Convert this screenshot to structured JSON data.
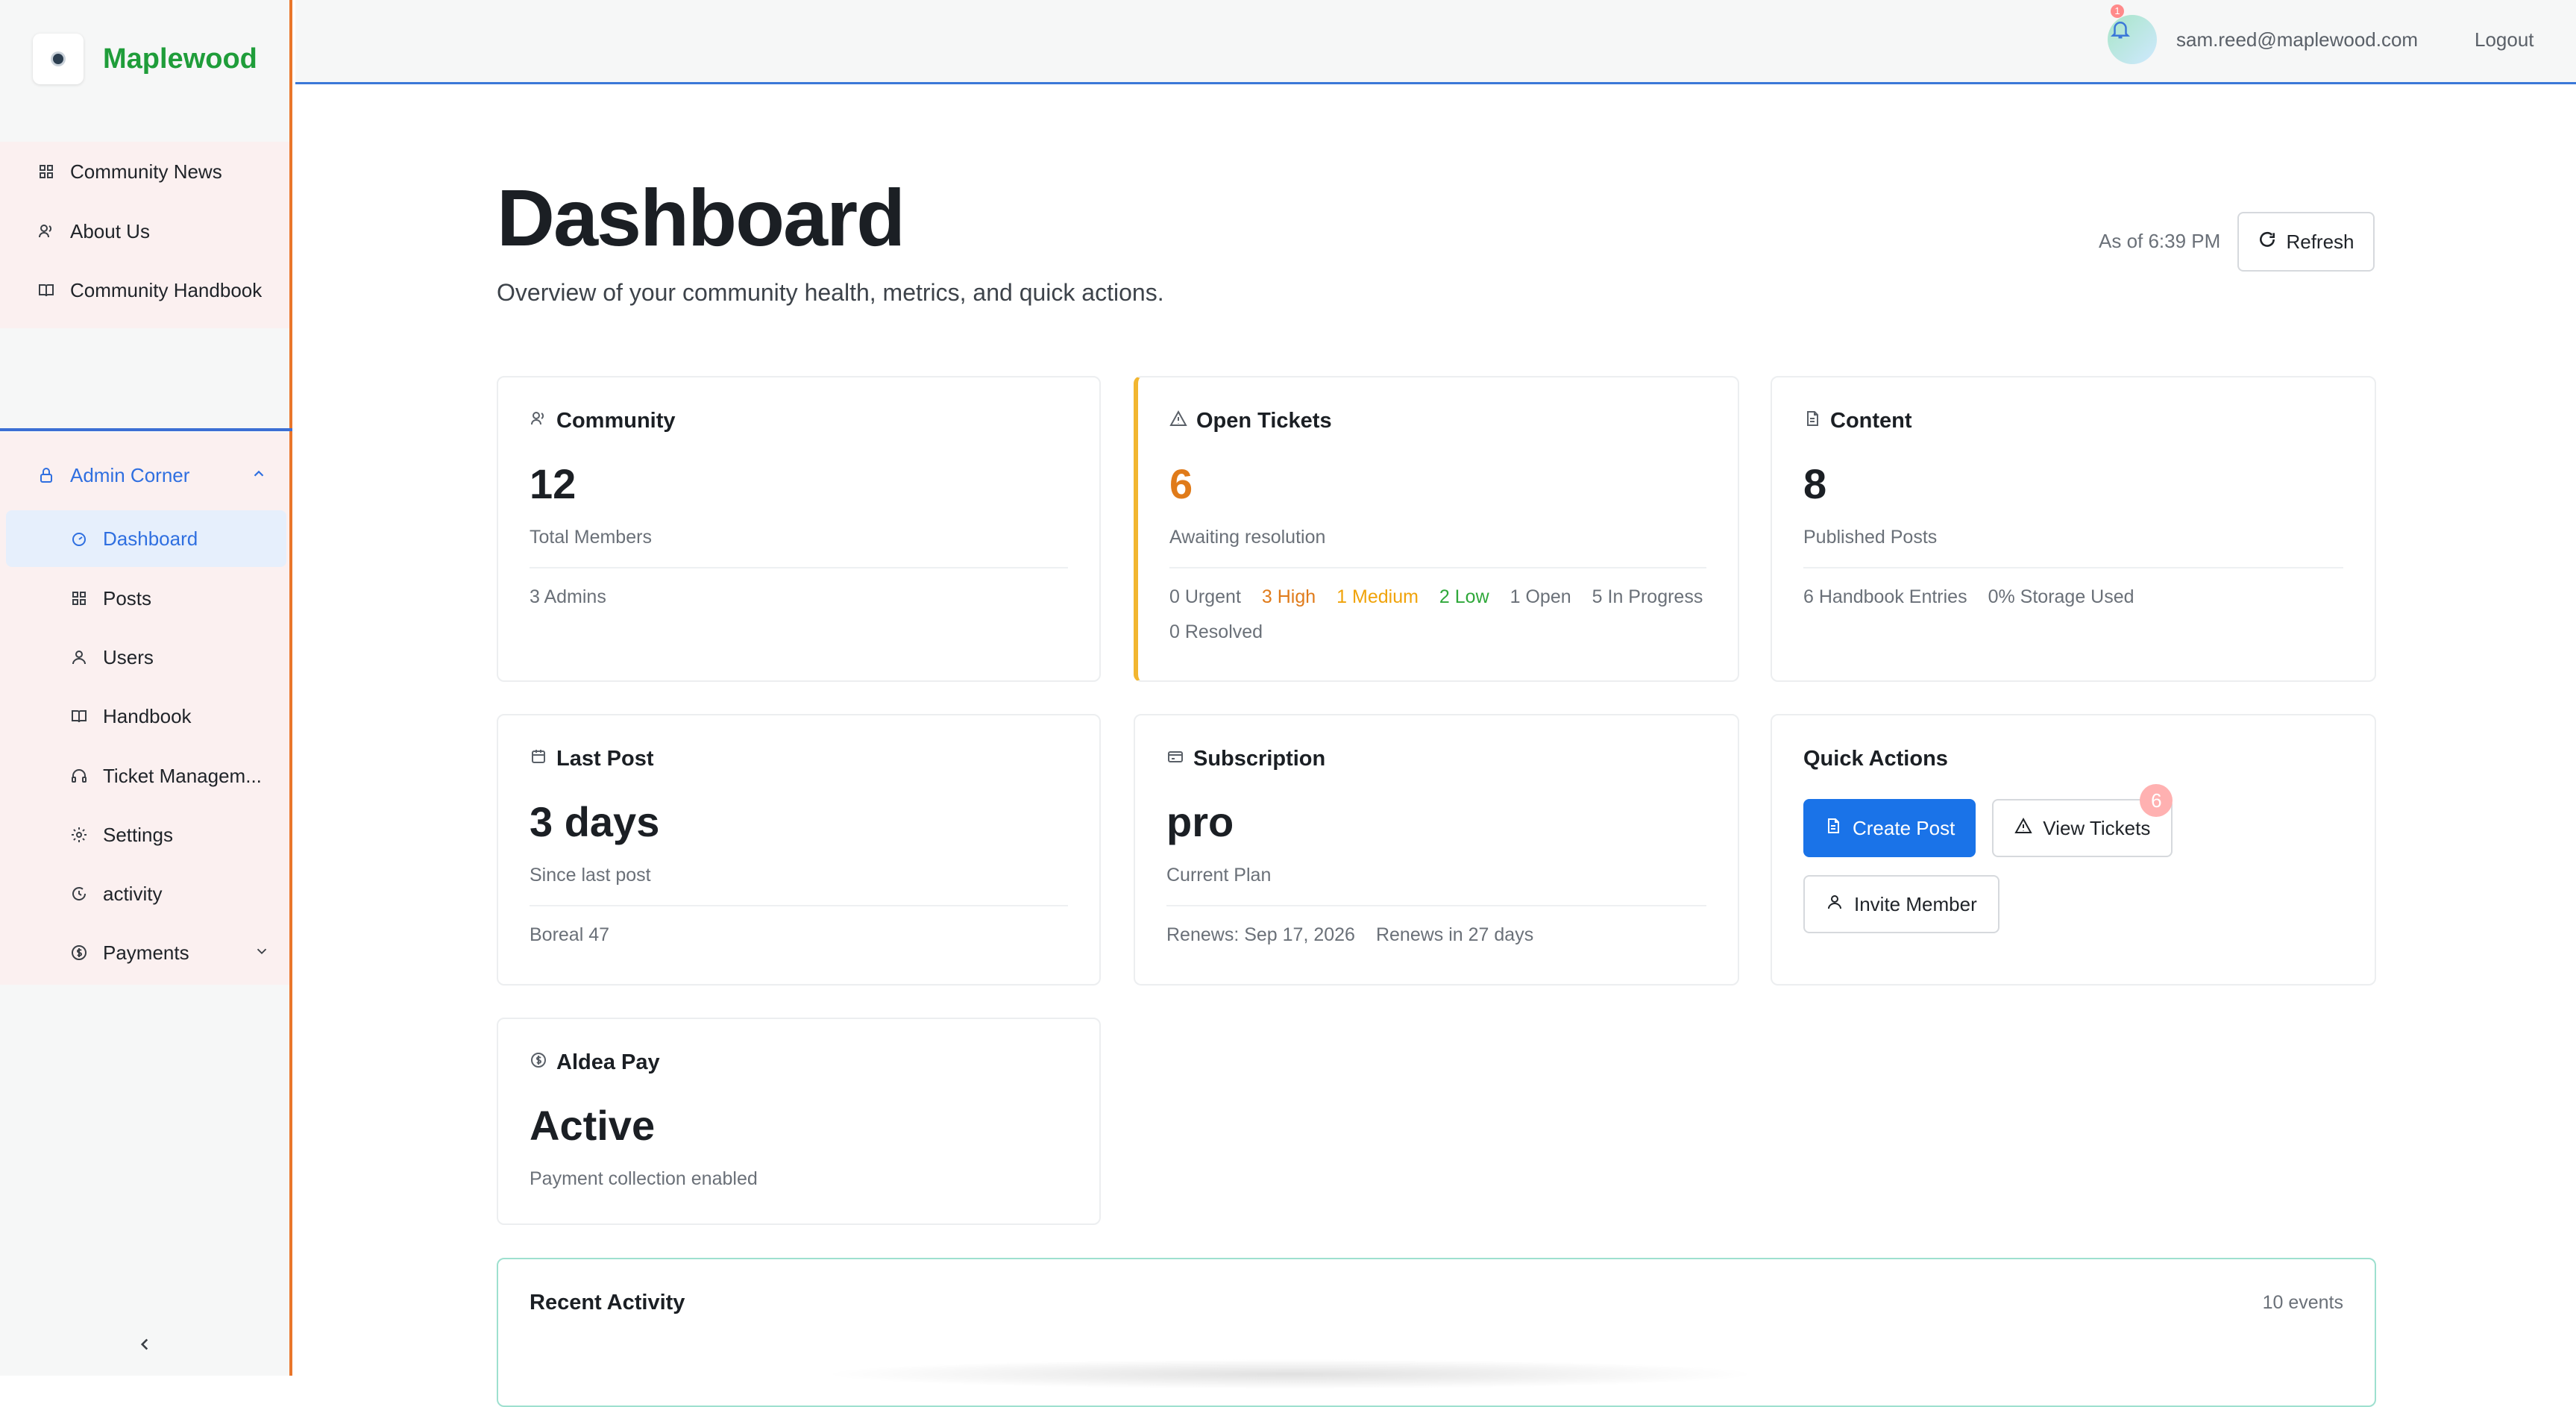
{
  "brand": {
    "name": "Maplewood"
  },
  "nav": {
    "main": [
      {
        "label": "Community News",
        "icon": "grid-icon"
      },
      {
        "label": "About Us",
        "icon": "people-icon"
      },
      {
        "label": "Community Handbook",
        "icon": "book-icon"
      }
    ],
    "admin": {
      "label": "Admin Corner",
      "items": [
        {
          "label": "Dashboard",
          "icon": "gauge-icon",
          "active": true
        },
        {
          "label": "Posts",
          "icon": "grid-icon"
        },
        {
          "label": "Users",
          "icon": "user-icon"
        },
        {
          "label": "Handbook",
          "icon": "book-icon"
        },
        {
          "label": "Ticket Managem...",
          "icon": "headset-icon"
        },
        {
          "label": "Settings",
          "icon": "gear-icon"
        },
        {
          "label": "activity",
          "icon": "history-icon"
        },
        {
          "label": "Payments",
          "icon": "dollar-icon"
        }
      ]
    }
  },
  "topbar": {
    "email": "sam.reed@maplewood.com",
    "logout": "Logout",
    "notification_count": "1"
  },
  "header": {
    "title": "Dashboard",
    "subtitle": "Overview of your community health, metrics, and quick actions.",
    "as_of": "As of 6:39 PM",
    "refresh": "Refresh"
  },
  "cards": {
    "community": {
      "title": "Community",
      "value": "12",
      "label": "Total Members",
      "foot": [
        "3 Admins"
      ]
    },
    "tickets": {
      "title": "Open Tickets",
      "value": "6",
      "label": "Awaiting resolution",
      "foot": [
        "0 Urgent",
        "3 High",
        "1 Medium",
        "2 Low",
        "1 Open",
        "5 In Progress",
        "0 Resolved"
      ]
    },
    "content": {
      "title": "Content",
      "value": "8",
      "label": "Published Posts",
      "foot": [
        "6 Handbook Entries",
        "0% Storage Used"
      ]
    },
    "last_post": {
      "title": "Last Post",
      "value": "3 days",
      "label": "Since last post",
      "foot": [
        "Boreal 47"
      ]
    },
    "subscription": {
      "title": "Subscription",
      "value": "pro",
      "label": "Current Plan",
      "foot": [
        "Renews: Sep 17, 2026",
        "Renews in 27 days"
      ]
    },
    "quick_actions": {
      "title": "Quick Actions",
      "create_post": "Create Post",
      "view_tickets": "View Tickets",
      "view_tickets_badge": "6",
      "invite_member": "Invite Member"
    },
    "aldea": {
      "title": "Aldea Pay",
      "value": "Active",
      "label": "Payment collection enabled"
    }
  },
  "activity": {
    "title": "Recent Activity",
    "count": "10 events"
  },
  "colors": {
    "accent": "#1a73e8",
    "brand": "#1f9d3a",
    "ticket_accent": "#f2b630",
    "sidebar_border": "#e9762b"
  }
}
